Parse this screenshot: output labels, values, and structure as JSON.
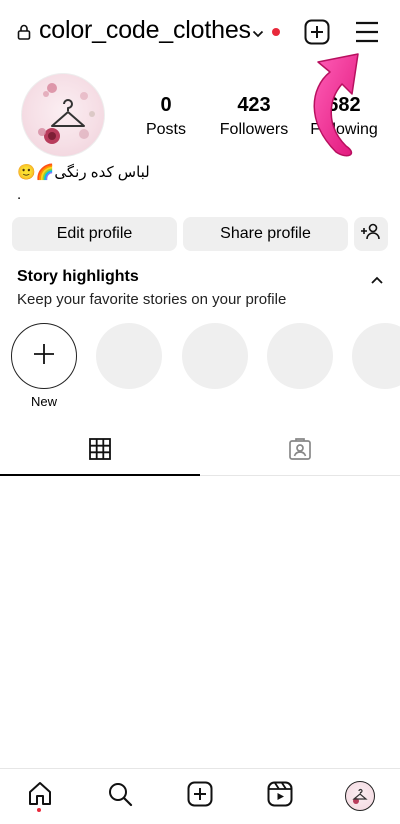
{
  "header": {
    "username": "color_code_clothes",
    "icons": [
      "lock-icon",
      "chevron-down-icon",
      "notification-dot",
      "new-post-icon",
      "menu-icon"
    ]
  },
  "profile": {
    "stats": [
      {
        "value": "0",
        "label": "Posts"
      },
      {
        "value": "423",
        "label": "Followers"
      },
      {
        "value": "682",
        "label": "Following"
      }
    ],
    "bio_line1": "لباس کده رنگی🌈🙂",
    "bio_line2": "."
  },
  "actions": {
    "edit_label": "Edit profile",
    "share_label": "Share profile"
  },
  "highlights": {
    "title": "Story highlights",
    "subtitle": "Keep your favorite stories on your profile",
    "new_label": "New"
  },
  "colors": {
    "accent_pink": "#ff2d9a",
    "notification_red": "#e8293b",
    "button_gray": "#efefef"
  }
}
